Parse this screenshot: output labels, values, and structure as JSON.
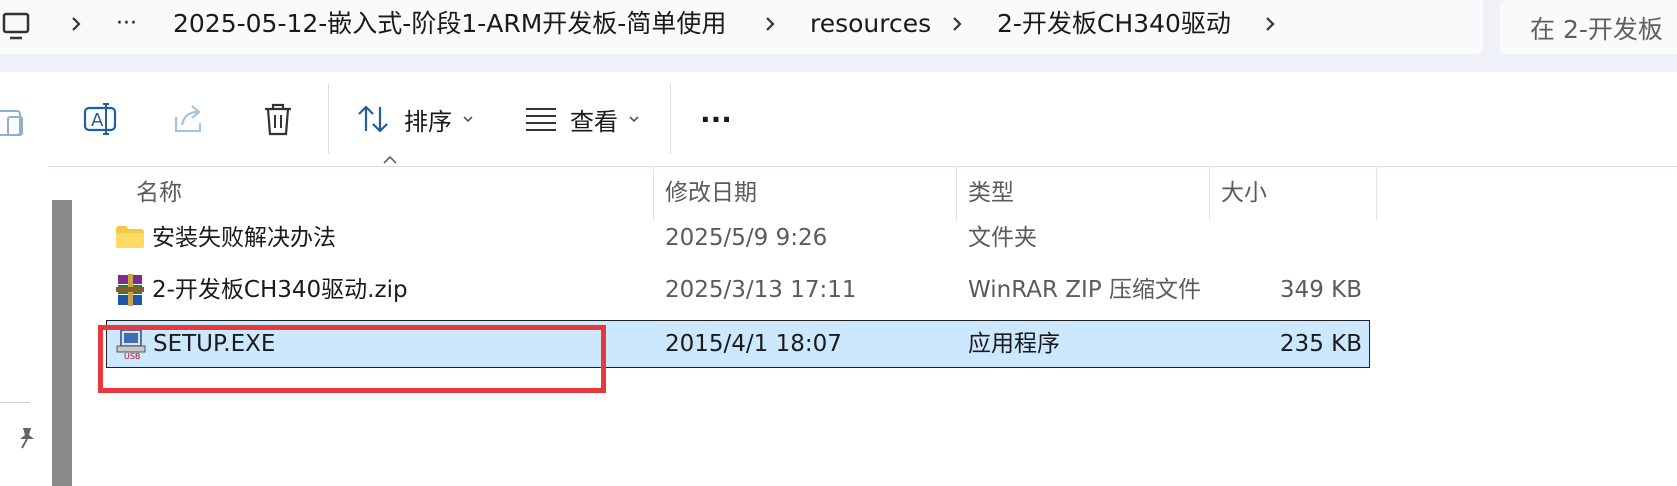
{
  "breadcrumb": {
    "ellipsis": "···",
    "items": [
      "2025-05-12-嵌入式-阶段1-ARM开发板-简单使用",
      "resources",
      "2-开发板CH340驱动"
    ]
  },
  "search": {
    "placeholder": "在 2-开发板"
  },
  "toolbar": {
    "sort_label": "排序",
    "view_label": "查看",
    "more_label": "···"
  },
  "columns": {
    "name": "名称",
    "modified": "修改日期",
    "type": "类型",
    "size": "大小"
  },
  "files": [
    {
      "name": "安装失败解决办法",
      "modified": "2025/5/9 9:26",
      "type": "文件夹",
      "size": "",
      "icon": "folder-icon"
    },
    {
      "name": "2-开发板CH340驱动.zip",
      "modified": "2025/3/13 17:11",
      "type": "WinRAR ZIP 压缩文件",
      "size": "349 KB",
      "icon": "winrar-icon"
    },
    {
      "name": "SETUP.EXE",
      "modified": "2015/4/1 18:07",
      "type": "应用程序",
      "size": "235 KB",
      "icon": "usb-setup-icon"
    }
  ],
  "colors": {
    "selection": "#cce8ff",
    "highlight": "#e8383d",
    "folder": "#f2c94c"
  }
}
